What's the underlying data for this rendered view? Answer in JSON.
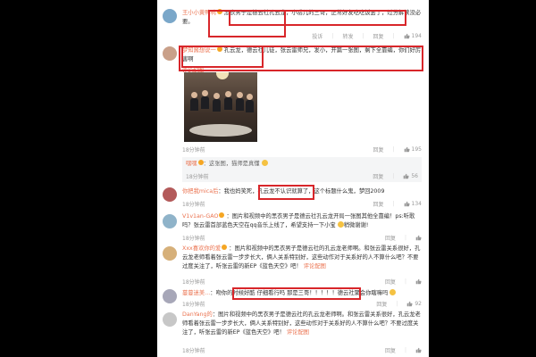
{
  "comments": [
    {
      "author": "王小小黄鸭鸭",
      "text": "黑衣男子是德云社孔云龙，小岳儿的三哥，正常好友吃吃饭罢了，过分解读没必要。",
      "time": "",
      "actions": [
        "投诉",
        "转发",
        "回复"
      ],
      "likes": "194"
    },
    {
      "author": "梦知酱想说一",
      "text": "孔云龙，德云社儿徒，张云雷师兄，发小，开篇一张图，剩下全靠编，你们好厉害啊",
      "image_label": "评论配图",
      "time": "18分钟前",
      "actions": [
        "回复"
      ],
      "likes": "195",
      "reply": {
        "author": "嘿嘿",
        "text": "：这张图，猫师是真懂",
        "time": "18分钟前",
        "actions": [
          "回复"
        ],
        "likes": "56"
      }
    },
    {
      "author": "你把我mica后",
      "text": "：我也妈笑死，孔云龙不认识就算了，这个标题什么鬼，梦回2009",
      "time": "18分钟前",
      "actions": [
        "回复"
      ],
      "likes": "134"
    },
    {
      "author": "V1v1an-GAO",
      "text": "：图片和视频中的黑衣男子是德云社孔云龙开局一张图其他全靠编！ps:听歌吗？张云雷首部蓝色天空在qq音乐上线了，希望支持一下小宝",
      "extra": "稍微谢谢!",
      "time": "18分钟前",
      "actions": [
        "回复"
      ],
      "likes": ""
    },
    {
      "author": "Xxx喜欢你的爱",
      "text": "：图片和视频中的黑衣男子是德云社的孔云龙老师啊。和张云雷关系很好，孔云龙老师看着张云雷一步步长大，俩人关系特别好，这些动作对于关系好的人不算什么吧？不要过度关注了，听张云雷的新EP《蓝色天空》吧！",
      "image_label": "评论配图",
      "time": "18分钟前",
      "actions": [
        "回复"
      ],
      "likes": ""
    },
    {
      "author": "蔓蔓迷美...",
      "text": "：吻你的时候好酷 仔细看行吗 那是三哥！！！！！德云社聚会你瞎嘛吗",
      "time": "18分钟前",
      "actions": [
        "回复"
      ],
      "likes": "92"
    },
    {
      "author": "DanYang的",
      "text": "：图片和视频中的黑衣男子是德云社的孔云龙老师啊。和张云雷关系很好，孔云龙老师看着张云雷一步步长大，俩人关系特别好，这些动作对于关系好的人不算什么吧？不要过度关注了，听张云雷的新EP《蓝色天空》吧！",
      "image_label": "评论配图",
      "time": "18分钟前",
      "actions": [
        "回复"
      ],
      "likes": ""
    }
  ],
  "colors": {
    "highlight": "#d8262a",
    "author": "#eb7350",
    "meta": "#999999",
    "background": "#000000"
  }
}
